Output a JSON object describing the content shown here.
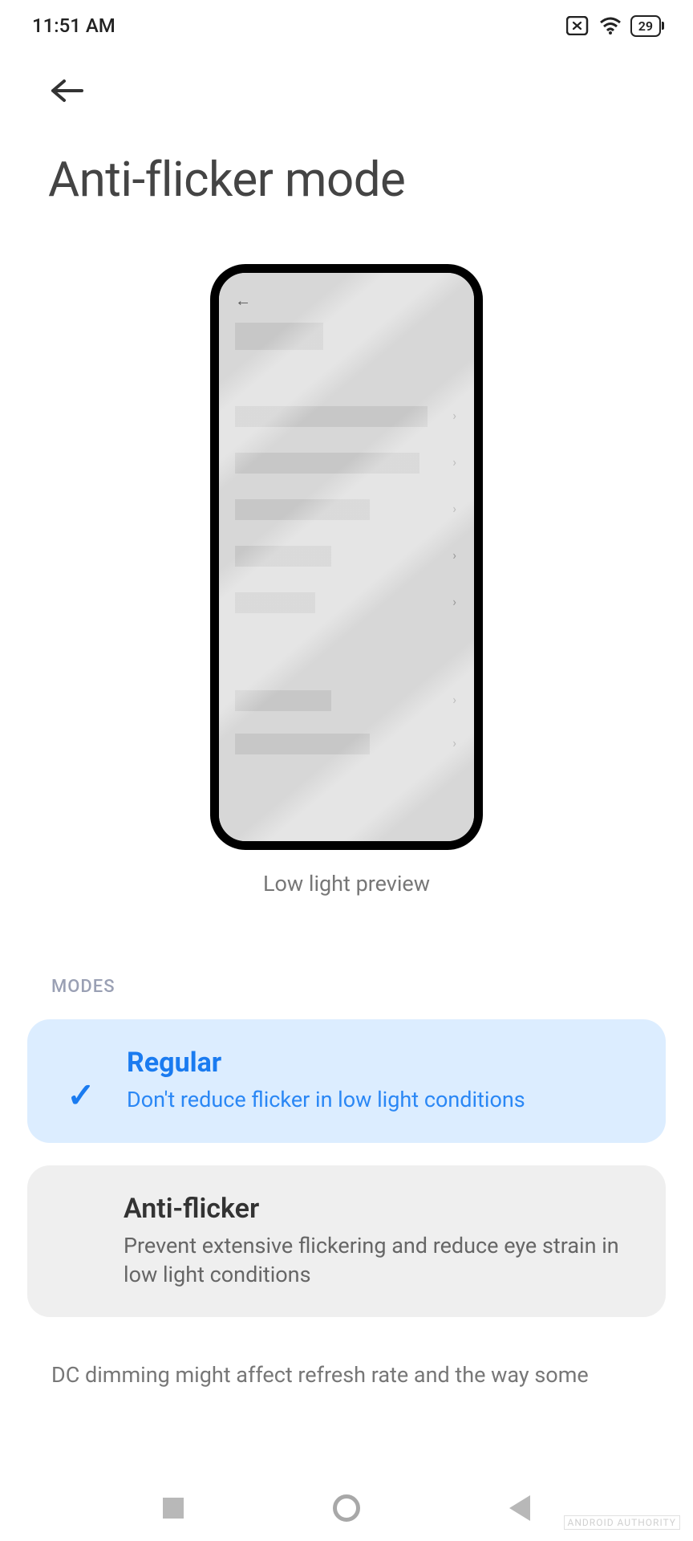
{
  "status": {
    "time": "11:51 AM",
    "battery": "29"
  },
  "page": {
    "title": "Anti-flicker mode",
    "preview_caption": "Low light preview"
  },
  "section": {
    "label": "MODES"
  },
  "options": {
    "regular": {
      "title": "Regular",
      "desc": "Don't reduce flicker in low light conditions"
    },
    "anti": {
      "title": "Anti-flicker",
      "desc": "Prevent extensive flickering and reduce eye strain in low light conditions"
    }
  },
  "footer_hint": "DC dimming might affect refresh rate and the way some",
  "watermark": "ANDROID AUTHORITY"
}
